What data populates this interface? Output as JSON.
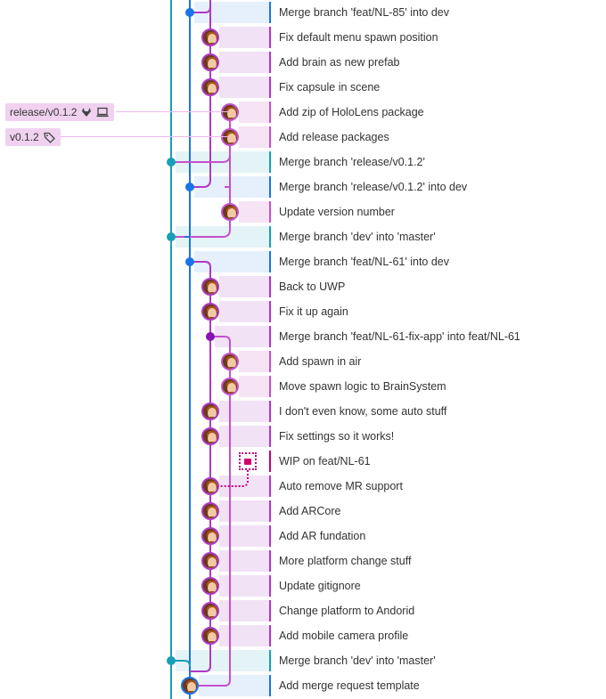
{
  "colors": {
    "master": "#179fb7",
    "dev": "#1a73e8",
    "feature": "#b038c6",
    "feature_dark": "#8a12b5",
    "feature_light": "#c551cc",
    "stash": "#c2007a",
    "ref_bg": "#f0d2f0"
  },
  "refs": [
    {
      "label": "release/v0.1.2",
      "icons": [
        "gitlab-icon",
        "laptop-icon"
      ]
    },
    {
      "label": "v0.1.2",
      "icons": [
        "tag-icon"
      ]
    }
  ],
  "commits": [
    {
      "message": "Merge branch 'feat/NL-85' into dev",
      "node": "dot",
      "lane": "dev"
    },
    {
      "message": "Fix default menu spawn position",
      "node": "avatar",
      "lane": "feature"
    },
    {
      "message": "Add brain as new prefab",
      "node": "avatar",
      "lane": "feature"
    },
    {
      "message": "Fix capsule in scene",
      "node": "avatar",
      "lane": "feature"
    },
    {
      "message": "Add zip of HoloLens package",
      "node": "avatar",
      "lane": "release"
    },
    {
      "message": "Add release packages",
      "node": "avatar",
      "lane": "release"
    },
    {
      "message": "Merge branch 'release/v0.1.2'",
      "node": "dot",
      "lane": "master"
    },
    {
      "message": "Merge branch 'release/v0.1.2' into dev",
      "node": "dot",
      "lane": "dev"
    },
    {
      "message": "Update version number",
      "node": "avatar",
      "lane": "release"
    },
    {
      "message": "Merge branch 'dev' into 'master'",
      "node": "dot",
      "lane": "master"
    },
    {
      "message": "Merge branch 'feat/NL-61' into dev",
      "node": "dot",
      "lane": "dev"
    },
    {
      "message": "Back to UWP",
      "node": "avatar",
      "lane": "feature"
    },
    {
      "message": "Fix it up again",
      "node": "avatar",
      "lane": "feature"
    },
    {
      "message": "Merge branch 'feat/NL-61-fix-app' into feat/NL-61",
      "node": "dot",
      "lane": "feature"
    },
    {
      "message": "Add spawn in air",
      "node": "avatar",
      "lane": "release"
    },
    {
      "message": "Move spawn logic to BrainSystem",
      "node": "avatar",
      "lane": "release"
    },
    {
      "message": "I don't even know, some auto stuff",
      "node": "avatar",
      "lane": "feature"
    },
    {
      "message": "Fix settings so it works!",
      "node": "avatar",
      "lane": "feature"
    },
    {
      "message": "WIP on feat/NL-61",
      "node": "stash",
      "lane": "stash"
    },
    {
      "message": "Auto remove MR support",
      "node": "avatar",
      "lane": "feature"
    },
    {
      "message": "Add ARCore",
      "node": "avatar",
      "lane": "feature"
    },
    {
      "message": "Add AR fundation",
      "node": "avatar",
      "lane": "feature"
    },
    {
      "message": "More platform change stuff",
      "node": "avatar",
      "lane": "feature"
    },
    {
      "message": "Update gitignore",
      "node": "avatar",
      "lane": "feature"
    },
    {
      "message": "Change platform to Andorid",
      "node": "avatar",
      "lane": "feature"
    },
    {
      "message": "Add mobile camera profile",
      "node": "avatar",
      "lane": "feature"
    },
    {
      "message": "Merge branch 'dev' into 'master'",
      "node": "dot",
      "lane": "master"
    },
    {
      "message": "Add merge request template",
      "node": "avatar",
      "lane": "dev"
    }
  ]
}
